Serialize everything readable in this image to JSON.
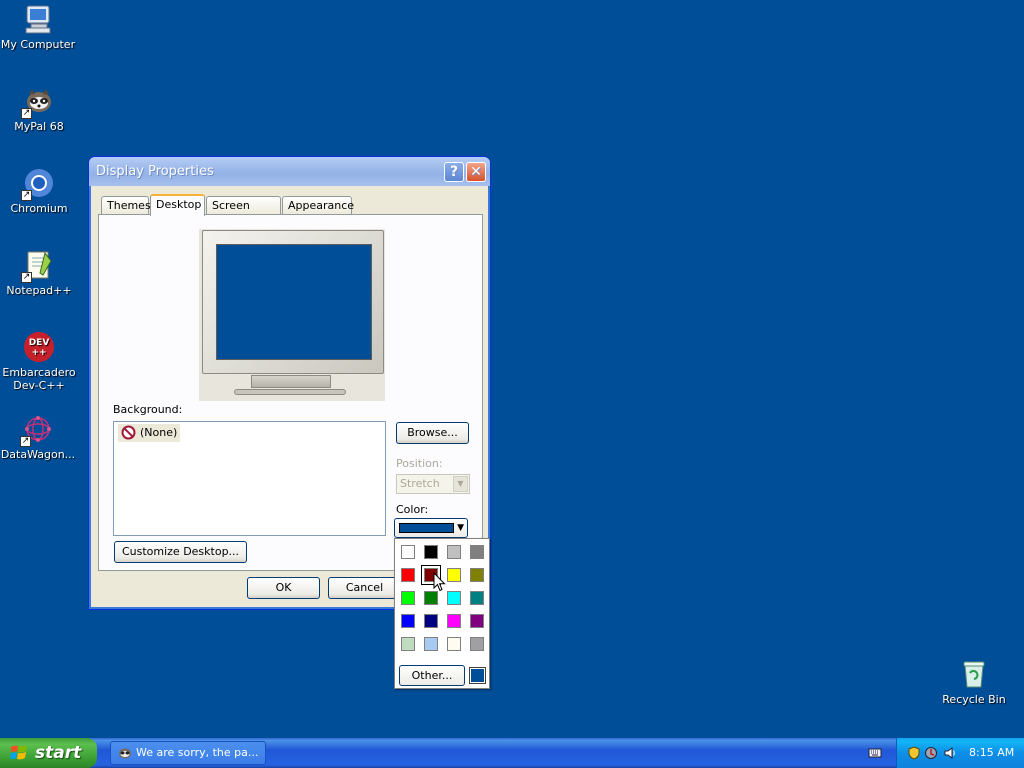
{
  "desktop": {
    "background_color": "#004e98",
    "icons": [
      {
        "label": "My Computer",
        "icon": "computer-icon"
      },
      {
        "label": "MyPal 68",
        "icon": "mypal-raccoon-icon"
      },
      {
        "label": "Chromium",
        "icon": "chromium-icon"
      },
      {
        "label": "Notepad++",
        "icon": "notepadpp-icon"
      },
      {
        "label": "Embarcadero Dev-C++",
        "icon": "devcpp-icon"
      },
      {
        "label": "DataWagon...",
        "icon": "datawagon-icon"
      },
      {
        "label": "Recycle Bin",
        "icon": "recycle-bin-icon"
      }
    ]
  },
  "dialog": {
    "title": "Display Properties",
    "help_label": "?",
    "close_label": "✕",
    "tabs": [
      {
        "label": "Themes",
        "active": false
      },
      {
        "label": "Desktop",
        "active": true
      },
      {
        "label": "Screen Saver",
        "active": false
      },
      {
        "label": "Appearance",
        "active": false
      }
    ],
    "background_label": "Background:",
    "background_items": [
      {
        "label": "(None)",
        "selected": true
      }
    ],
    "browse_label": "Browse...",
    "position_label": "Position:",
    "position_value": "Stretch",
    "color_label": "Color:",
    "color_value": "#004e98",
    "customize_label": "Customize Desktop...",
    "ok_label": "OK",
    "cancel_label": "Cancel"
  },
  "color_popup": {
    "colors": [
      "#ffffff",
      "#000000",
      "#c0c0c0",
      "#808080",
      "#ff0000",
      "#800000",
      "#ffff00",
      "#808000",
      "#00ff00",
      "#008000",
      "#00ffff",
      "#008080",
      "#0000ff",
      "#000080",
      "#ff00ff",
      "#800080",
      "#c0dcc0",
      "#a6caf0",
      "#fffbf0",
      "#a0a0a4"
    ],
    "selected_color": "#800000",
    "other_label": "Other...",
    "current_color": "#004e98"
  },
  "taskbar": {
    "start_label": "start",
    "task_items": [
      {
        "label": "We are sorry, the pa...",
        "icon": "mypal-raccoon-icon"
      }
    ],
    "clock": "8:15 AM"
  }
}
